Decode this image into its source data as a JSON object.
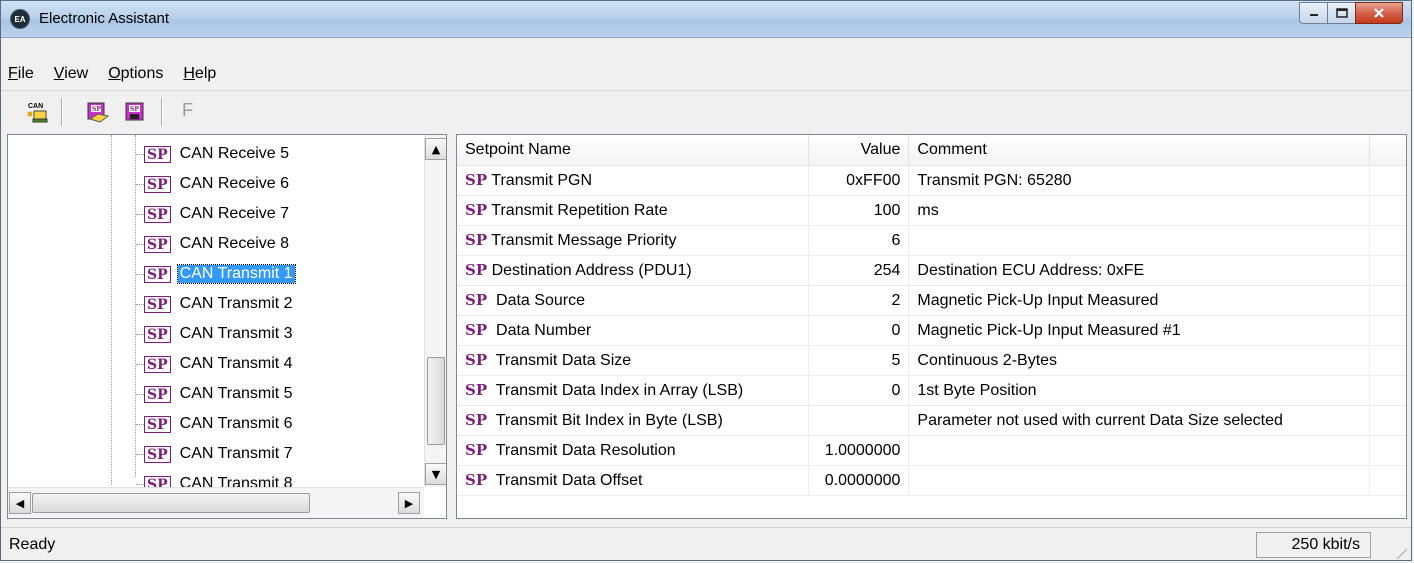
{
  "window": {
    "title": "Electronic Assistant",
    "icon": "EA"
  },
  "menu": [
    "File",
    "View",
    "Options",
    "Help"
  ],
  "toolbar": {
    "f_label": "F"
  },
  "tree": {
    "items": [
      {
        "label": "CAN Receive 5"
      },
      {
        "label": "CAN Receive 6"
      },
      {
        "label": "CAN Receive 7"
      },
      {
        "label": "CAN Receive 8"
      },
      {
        "label": "CAN Transmit 1",
        "selected": true
      },
      {
        "label": "CAN Transmit 2"
      },
      {
        "label": "CAN Transmit 3"
      },
      {
        "label": "CAN Transmit 4"
      },
      {
        "label": "CAN Transmit 5"
      },
      {
        "label": "CAN Transmit 6"
      },
      {
        "label": "CAN Transmit 7"
      },
      {
        "label": "CAN Transmit 8"
      }
    ],
    "sp_tag": "SP"
  },
  "table": {
    "headers": [
      "Setpoint Name",
      "Value",
      "Comment"
    ],
    "rows": [
      {
        "name": "Transmit PGN",
        "value": "0xFF00",
        "comment": "Transmit PGN: 65280"
      },
      {
        "name": "Transmit Repetition Rate",
        "value": "100",
        "comment": "ms"
      },
      {
        "name": "Transmit Message Priority",
        "value": "6",
        "comment": ""
      },
      {
        "name": "Destination Address (PDU1)",
        "value": "254",
        "comment": "Destination ECU Address: 0xFE"
      },
      {
        "name": " Data Source",
        "value": "2",
        "comment": "Magnetic Pick-Up Input Measured"
      },
      {
        "name": " Data Number",
        "value": "0",
        "comment": "Magnetic Pick-Up Input Measured #1"
      },
      {
        "name": " Transmit Data Size",
        "value": "5",
        "comment": "Continuous 2-Bytes"
      },
      {
        "name": " Transmit Data Index in Array (LSB)",
        "value": "0",
        "comment": "1st Byte Position"
      },
      {
        "name": " Transmit Bit Index in Byte (LSB)",
        "value": "",
        "comment": "Parameter not used with current Data Size selected"
      },
      {
        "name": " Transmit Data Resolution",
        "value": "1.0000000",
        "comment": ""
      },
      {
        "name": " Transmit Data Offset",
        "value": "0.0000000",
        "comment": ""
      }
    ]
  },
  "status": {
    "text": "Ready",
    "baud": "250 kbit/s"
  },
  "colors": {
    "sp_tag": "#7b1f7b",
    "selection": "#3399ff"
  }
}
